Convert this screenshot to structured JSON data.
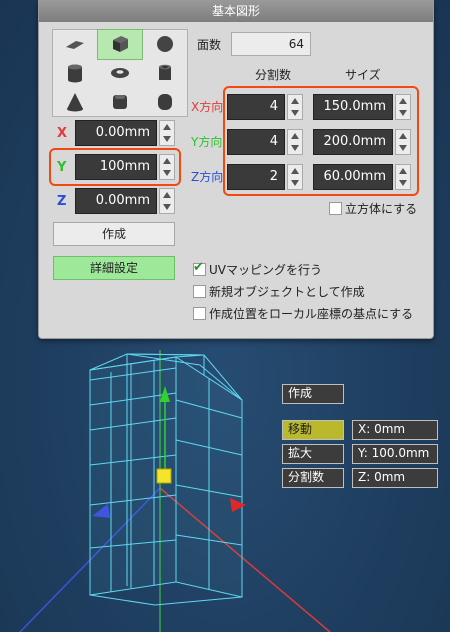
{
  "dialog": {
    "title": "基本図形",
    "shapes": [
      {
        "icon": "plane-icon"
      },
      {
        "icon": "cube-icon",
        "selected": true
      },
      {
        "icon": "sphere-icon"
      },
      {
        "icon": "cylinder-icon"
      },
      {
        "icon": "torus-icon"
      },
      {
        "icon": "tube-icon"
      },
      {
        "icon": "cone-icon"
      },
      {
        "icon": "rounded-cube-icon"
      },
      {
        "icon": "capsule-icon"
      }
    ],
    "position": {
      "x_label": "X",
      "x_value": "0.00mm",
      "y_label": "Y",
      "y_value": "100mm",
      "z_label": "Z",
      "z_value": "0.00mm"
    },
    "create_label": "作成",
    "details_label": "詳細設定",
    "face_count_label": "面数",
    "face_count_value": "64",
    "divisions_header": "分割数",
    "size_header": "サイズ",
    "dims": [
      {
        "label": "X方向",
        "div": "4",
        "size": "150.0mm",
        "color": "#e03a3a"
      },
      {
        "label": "Y方向",
        "div": "4",
        "size": "200.0mm",
        "color": "#2fbf2f"
      },
      {
        "label": "Z方向",
        "div": "2",
        "size": "60.00mm",
        "color": "#2a4fd6"
      }
    ],
    "cube_label": "立方体にする",
    "uv_label": "UVマッピングを行う",
    "new_obj_label": "新規オブジェクトとして作成",
    "local_label": "作成位置をローカル座標の基点にする"
  },
  "panel": {
    "create": "作成",
    "move": "移動",
    "scale": "拡大",
    "divisions": "分割数",
    "x": "X: 0mm",
    "y": "Y: 100.0mm",
    "z": "Z: 0mm"
  },
  "colors": {
    "highlight": "#f04a12",
    "axis_x": "#e03a3a",
    "axis_y": "#2fbf2f",
    "axis_z": "#2a4fd6",
    "wire": "#5fd8f0"
  }
}
